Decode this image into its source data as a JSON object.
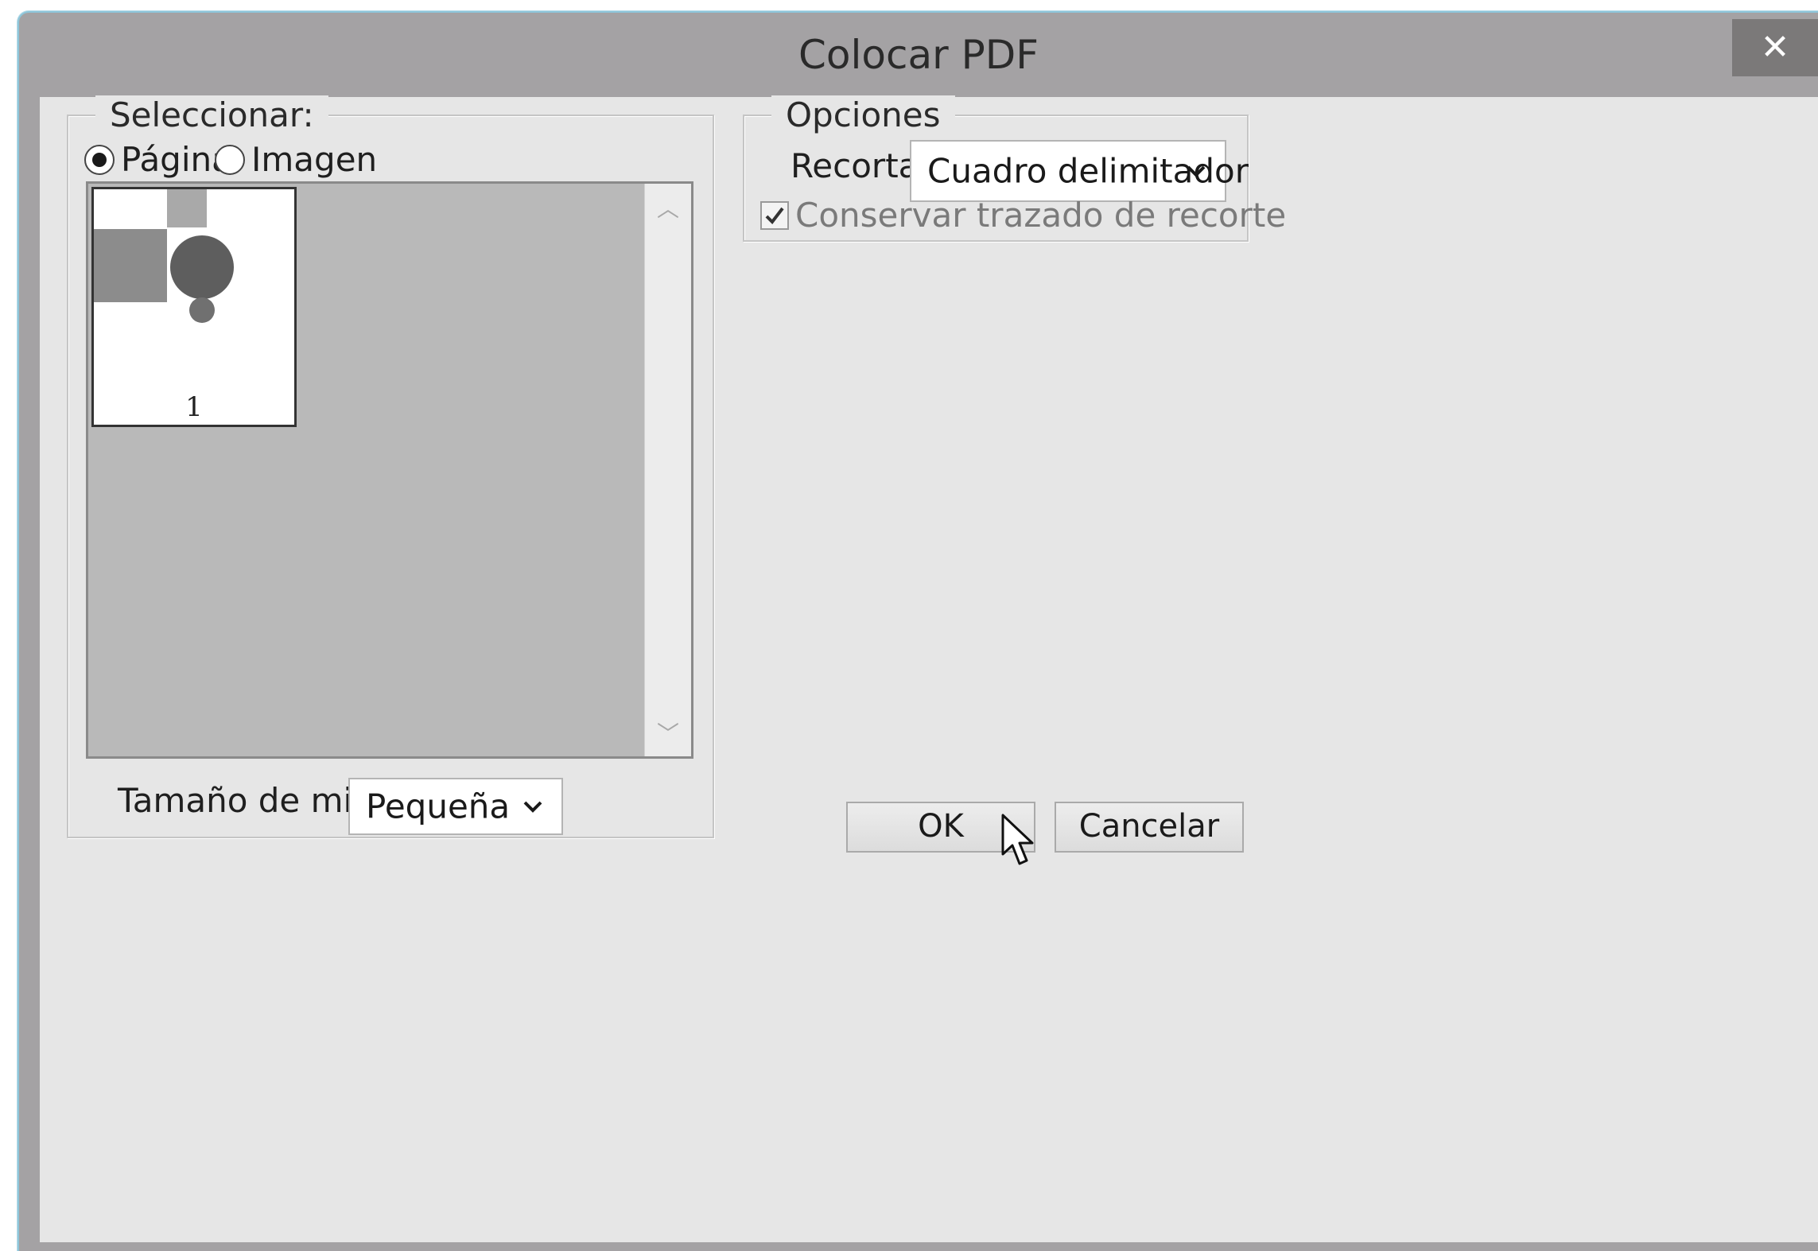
{
  "window": {
    "title": "Colocar PDF",
    "close_glyph": "✕"
  },
  "select_group": {
    "legend": "Seleccionar:",
    "radio_options": [
      {
        "label": "Página",
        "checked": true
      },
      {
        "label": "Imagen",
        "checked": false
      }
    ],
    "thumbnails": [
      {
        "page_number": "1",
        "selected": true
      }
    ],
    "thumbnail_size": {
      "label": "Tamaño de miniatura:",
      "selected": "Pequeña"
    }
  },
  "options_group": {
    "legend": "Opciones",
    "crop_to": {
      "label": "Recortar a:",
      "selected": "Cuadro delimitador"
    },
    "preserve_clipping_path": {
      "label": "Conservar trazado de recorte",
      "checked": true,
      "enabled": false
    }
  },
  "buttons": {
    "ok_label": "OK",
    "cancel_label": "Cancelar"
  },
  "colors": {
    "title_bar": "#a4a2a4",
    "client_background": "#e6e6e6",
    "thumbnail_area": "#b9b9b9",
    "close_button": "#7b7979",
    "window_border": "#8ec6da"
  },
  "icons": {
    "close": "close-icon",
    "dropdown": "chevron-down-icon",
    "scroll_up": "scroll-up-icon",
    "scroll_down": "scroll-down-icon",
    "check": "checkmark-icon",
    "cursor": "mouse-pointer-icon"
  }
}
